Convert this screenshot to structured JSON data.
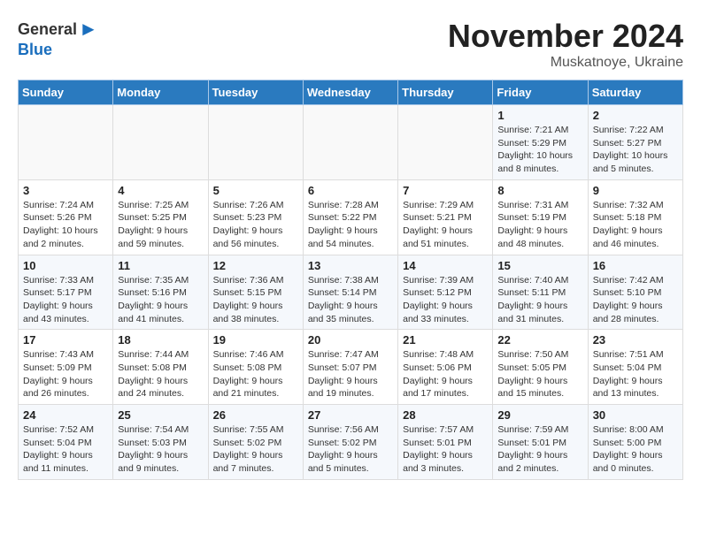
{
  "header": {
    "logo_general": "General",
    "logo_blue": "Blue",
    "month_title": "November 2024",
    "subtitle": "Muskatnoye, Ukraine"
  },
  "days_of_week": [
    "Sunday",
    "Monday",
    "Tuesday",
    "Wednesday",
    "Thursday",
    "Friday",
    "Saturday"
  ],
  "weeks": [
    [
      {
        "day": "",
        "info": ""
      },
      {
        "day": "",
        "info": ""
      },
      {
        "day": "",
        "info": ""
      },
      {
        "day": "",
        "info": ""
      },
      {
        "day": "",
        "info": ""
      },
      {
        "day": "1",
        "info": "Sunrise: 7:21 AM\nSunset: 5:29 PM\nDaylight: 10 hours and 8 minutes."
      },
      {
        "day": "2",
        "info": "Sunrise: 7:22 AM\nSunset: 5:27 PM\nDaylight: 10 hours and 5 minutes."
      }
    ],
    [
      {
        "day": "3",
        "info": "Sunrise: 7:24 AM\nSunset: 5:26 PM\nDaylight: 10 hours and 2 minutes."
      },
      {
        "day": "4",
        "info": "Sunrise: 7:25 AM\nSunset: 5:25 PM\nDaylight: 9 hours and 59 minutes."
      },
      {
        "day": "5",
        "info": "Sunrise: 7:26 AM\nSunset: 5:23 PM\nDaylight: 9 hours and 56 minutes."
      },
      {
        "day": "6",
        "info": "Sunrise: 7:28 AM\nSunset: 5:22 PM\nDaylight: 9 hours and 54 minutes."
      },
      {
        "day": "7",
        "info": "Sunrise: 7:29 AM\nSunset: 5:21 PM\nDaylight: 9 hours and 51 minutes."
      },
      {
        "day": "8",
        "info": "Sunrise: 7:31 AM\nSunset: 5:19 PM\nDaylight: 9 hours and 48 minutes."
      },
      {
        "day": "9",
        "info": "Sunrise: 7:32 AM\nSunset: 5:18 PM\nDaylight: 9 hours and 46 minutes."
      }
    ],
    [
      {
        "day": "10",
        "info": "Sunrise: 7:33 AM\nSunset: 5:17 PM\nDaylight: 9 hours and 43 minutes."
      },
      {
        "day": "11",
        "info": "Sunrise: 7:35 AM\nSunset: 5:16 PM\nDaylight: 9 hours and 41 minutes."
      },
      {
        "day": "12",
        "info": "Sunrise: 7:36 AM\nSunset: 5:15 PM\nDaylight: 9 hours and 38 minutes."
      },
      {
        "day": "13",
        "info": "Sunrise: 7:38 AM\nSunset: 5:14 PM\nDaylight: 9 hours and 35 minutes."
      },
      {
        "day": "14",
        "info": "Sunrise: 7:39 AM\nSunset: 5:12 PM\nDaylight: 9 hours and 33 minutes."
      },
      {
        "day": "15",
        "info": "Sunrise: 7:40 AM\nSunset: 5:11 PM\nDaylight: 9 hours and 31 minutes."
      },
      {
        "day": "16",
        "info": "Sunrise: 7:42 AM\nSunset: 5:10 PM\nDaylight: 9 hours and 28 minutes."
      }
    ],
    [
      {
        "day": "17",
        "info": "Sunrise: 7:43 AM\nSunset: 5:09 PM\nDaylight: 9 hours and 26 minutes."
      },
      {
        "day": "18",
        "info": "Sunrise: 7:44 AM\nSunset: 5:08 PM\nDaylight: 9 hours and 24 minutes."
      },
      {
        "day": "19",
        "info": "Sunrise: 7:46 AM\nSunset: 5:08 PM\nDaylight: 9 hours and 21 minutes."
      },
      {
        "day": "20",
        "info": "Sunrise: 7:47 AM\nSunset: 5:07 PM\nDaylight: 9 hours and 19 minutes."
      },
      {
        "day": "21",
        "info": "Sunrise: 7:48 AM\nSunset: 5:06 PM\nDaylight: 9 hours and 17 minutes."
      },
      {
        "day": "22",
        "info": "Sunrise: 7:50 AM\nSunset: 5:05 PM\nDaylight: 9 hours and 15 minutes."
      },
      {
        "day": "23",
        "info": "Sunrise: 7:51 AM\nSunset: 5:04 PM\nDaylight: 9 hours and 13 minutes."
      }
    ],
    [
      {
        "day": "24",
        "info": "Sunrise: 7:52 AM\nSunset: 5:04 PM\nDaylight: 9 hours and 11 minutes."
      },
      {
        "day": "25",
        "info": "Sunrise: 7:54 AM\nSunset: 5:03 PM\nDaylight: 9 hours and 9 minutes."
      },
      {
        "day": "26",
        "info": "Sunrise: 7:55 AM\nSunset: 5:02 PM\nDaylight: 9 hours and 7 minutes."
      },
      {
        "day": "27",
        "info": "Sunrise: 7:56 AM\nSunset: 5:02 PM\nDaylight: 9 hours and 5 minutes."
      },
      {
        "day": "28",
        "info": "Sunrise: 7:57 AM\nSunset: 5:01 PM\nDaylight: 9 hours and 3 minutes."
      },
      {
        "day": "29",
        "info": "Sunrise: 7:59 AM\nSunset: 5:01 PM\nDaylight: 9 hours and 2 minutes."
      },
      {
        "day": "30",
        "info": "Sunrise: 8:00 AM\nSunset: 5:00 PM\nDaylight: 9 hours and 0 minutes."
      }
    ]
  ]
}
